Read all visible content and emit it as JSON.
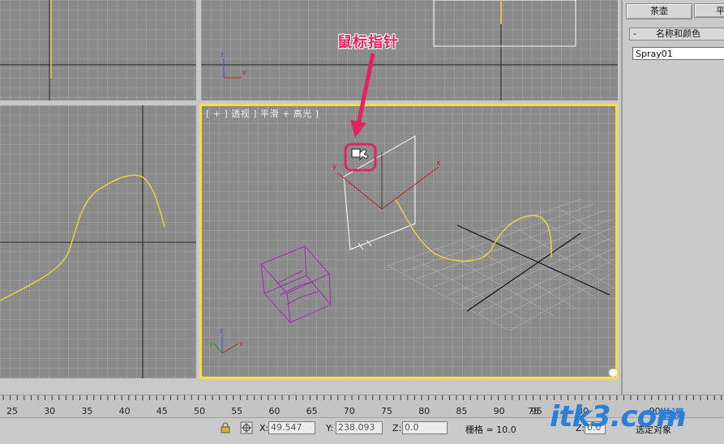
{
  "viewports": {
    "perspective_label": "[ + ] 透视 ] 平滑 + 高光 ]"
  },
  "annotation": {
    "text": "鼠标指针"
  },
  "command_panel": {
    "btn_teapot": "茶壶",
    "btn_plane_partial": "平",
    "rollout_title": "名称和颜色",
    "rollout_minus": "-",
    "object_name": "Spray01"
  },
  "timeline": {
    "ticks": [
      "25",
      "30",
      "35",
      "40",
      "45",
      "50",
      "55",
      "60",
      "65",
      "70",
      "75",
      "80",
      "85",
      "90",
      "95",
      "75",
      "80",
      "90"
    ]
  },
  "status_bar": {
    "x_label": "X:",
    "x_value": "49.547",
    "y_label": "Y:",
    "y_value": "238.093",
    "z_label": "Z:",
    "z_value": "0.0",
    "grid_label": "栅格 = 10.0",
    "z2_label": "Z:",
    "z2_value": "0.0",
    "selection_text": "选定对象"
  },
  "watermark": {
    "main": "itk3.com",
    "sub": "一堂课"
  },
  "colors": {
    "viewport_bg": "#8a8a8a",
    "active_border": "#f2e33a",
    "annotation": "#e0245e",
    "curve": "#e8d23a",
    "watermark": "#2a7fd6"
  }
}
